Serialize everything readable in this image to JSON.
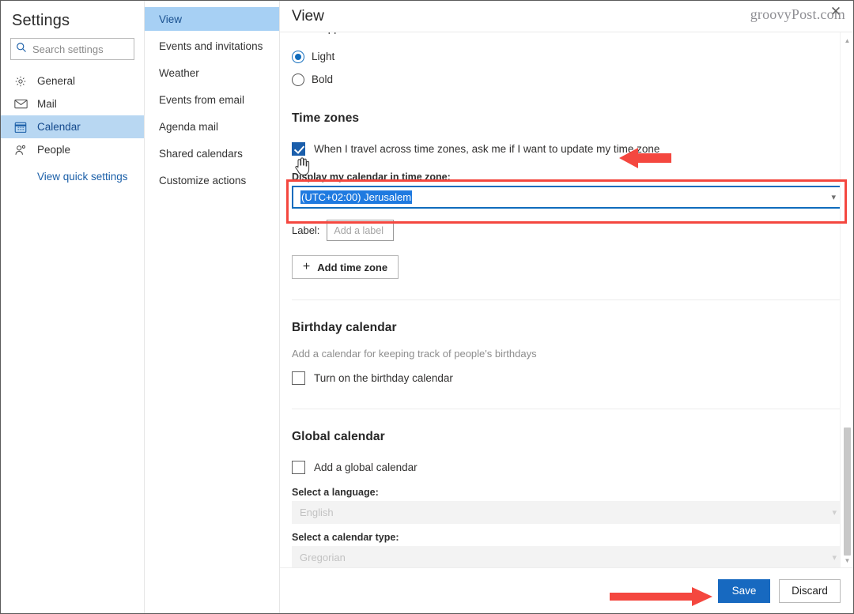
{
  "window": {
    "watermark": "groovyPost.com",
    "close_label": "✕"
  },
  "settings_pane": {
    "title": "Settings",
    "search": {
      "placeholder": "Search settings",
      "icon": "search-icon"
    },
    "items": [
      {
        "label": "General",
        "icon": "gear-icon",
        "selected": false
      },
      {
        "label": "Mail",
        "icon": "mail-icon",
        "selected": false
      },
      {
        "label": "Calendar",
        "icon": "calendar-icon",
        "selected": true
      },
      {
        "label": "People",
        "icon": "people-icon",
        "selected": false
      }
    ],
    "quick_settings_link": "View quick settings"
  },
  "sub_pane": {
    "items": [
      {
        "label": "View",
        "selected": true
      },
      {
        "label": "Events and invitations",
        "selected": false
      },
      {
        "label": "Weather",
        "selected": false
      },
      {
        "label": "Events from email",
        "selected": false
      },
      {
        "label": "Agenda mail",
        "selected": false
      },
      {
        "label": "Shared calendars",
        "selected": false
      },
      {
        "label": "Customize actions",
        "selected": false
      }
    ]
  },
  "content": {
    "header_title": "View",
    "event_appearance": {
      "label": "Event appearance:",
      "options": [
        {
          "label": "Light",
          "checked": true
        },
        {
          "label": "Bold",
          "checked": false
        }
      ]
    },
    "time_zones": {
      "heading": "Time zones",
      "travel_checkbox": {
        "label": "When I travel across time zones, ask me if I want to update my time zone",
        "checked": true
      },
      "display_label": "Display my calendar in time zone:",
      "display_value": "(UTC+02:00) Jerusalem",
      "label_caption": "Label:",
      "label_placeholder": "Add a label",
      "add_button": "Add time zone",
      "add_button_icon": "plus-icon"
    },
    "birthday_calendar": {
      "heading": "Birthday calendar",
      "description": "Add a calendar for keeping track of people's birthdays",
      "checkbox_label": "Turn on the birthday calendar",
      "checked": false
    },
    "global_calendar": {
      "heading": "Global calendar",
      "checkbox_label": "Add a global calendar",
      "checked": false,
      "language_label": "Select a language:",
      "language_value": "English",
      "calendar_type_label": "Select a calendar type:",
      "calendar_type_value": "Gregorian"
    }
  },
  "footer": {
    "save_label": "Save",
    "discard_label": "Discard"
  },
  "annotations": {
    "highlight_color": "#f4473f",
    "arrow_color": "#f4473f"
  },
  "theme": {
    "accent_blue": "#1769c0",
    "sidebar_selected": "#b8d7f2",
    "sub_selected": "#a7d0f4",
    "selection_blue": "#1f7ae0"
  }
}
